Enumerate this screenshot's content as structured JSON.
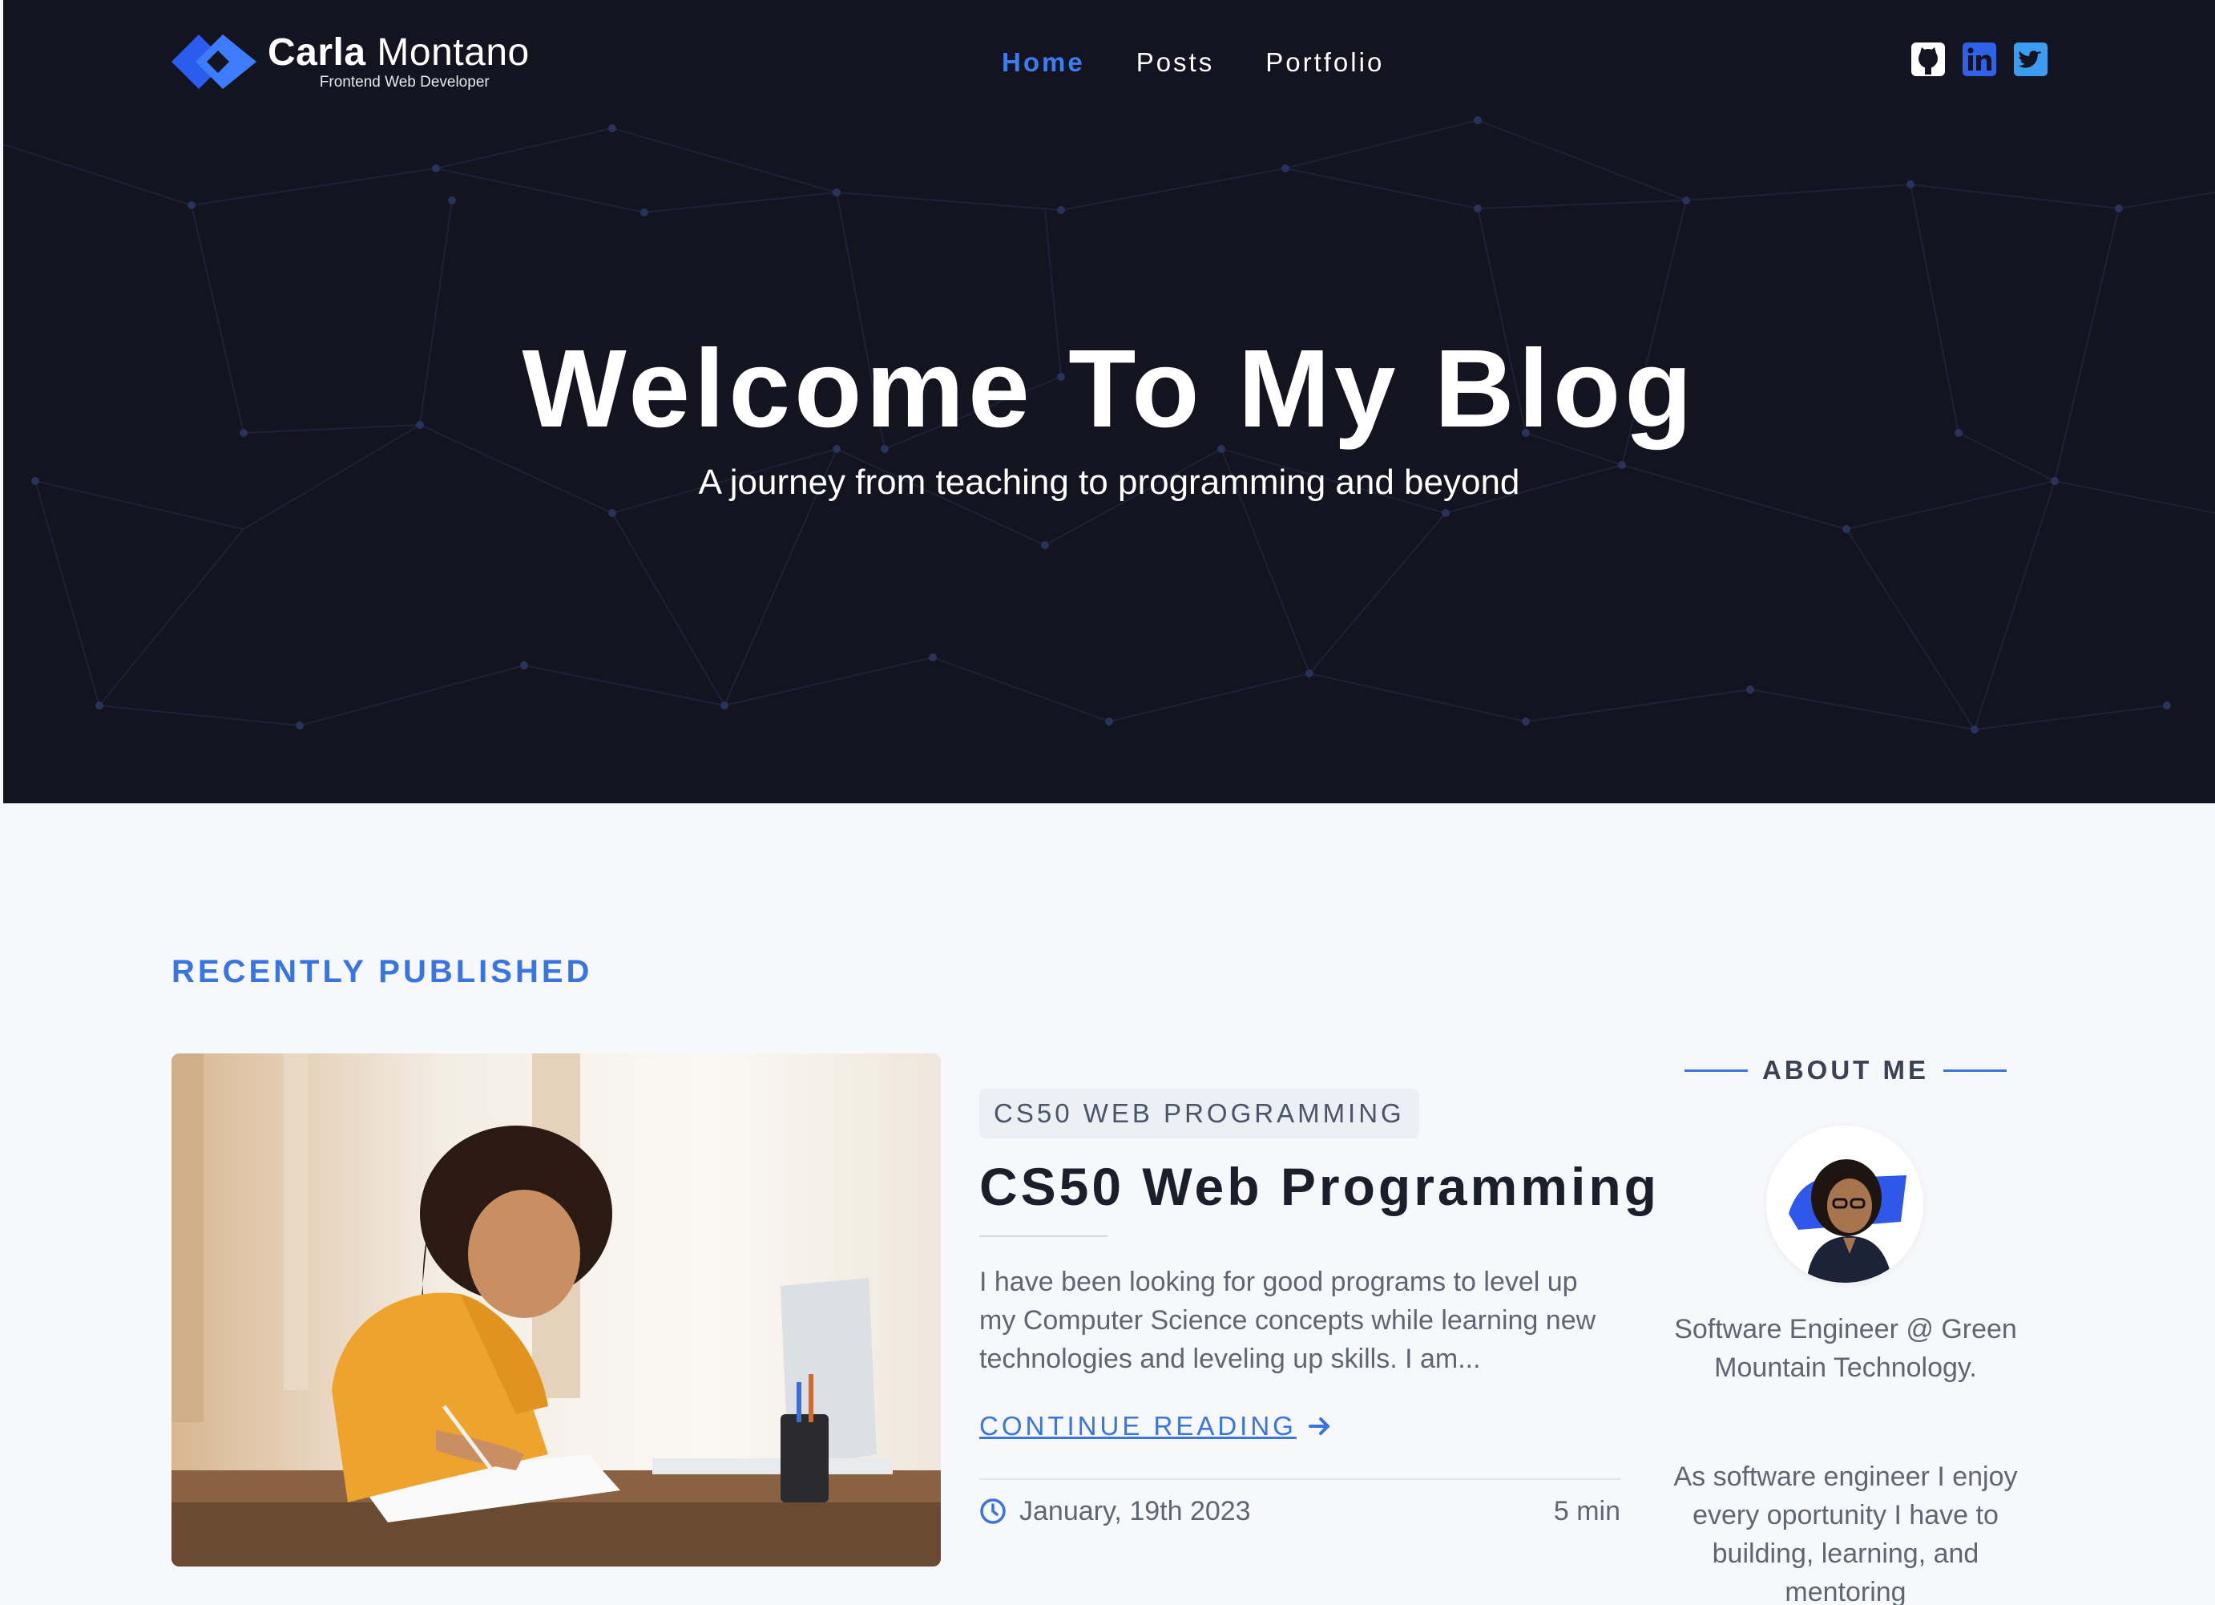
{
  "brand": {
    "first_name": "Carla",
    "last_name": "Montano",
    "tagline": "Frontend Web Developer",
    "accent": "#3b7df5"
  },
  "nav": {
    "items": [
      {
        "label": "Home",
        "active": true
      },
      {
        "label": "Posts",
        "active": false
      },
      {
        "label": "Portfolio",
        "active": false
      }
    ]
  },
  "social": {
    "icons": [
      "github-icon",
      "linkedin-icon",
      "twitter-icon"
    ]
  },
  "hero": {
    "title": "Welcome To My Blog",
    "subtitle": "A journey from teaching to programming and beyond"
  },
  "main": {
    "section_label": "RECENTLY PUBLISHED",
    "post": {
      "category": "CS50 WEB PROGRAMMING",
      "title": "CS50 Web Programming",
      "excerpt": "I have been looking for good programs to level up my Computer Science concepts while learning new technologies and leveling up skills. I am...",
      "continue_label": "CONTINUE READING",
      "date": "January, 19th 2023",
      "read_time": "5 min"
    }
  },
  "sidebar": {
    "about_heading": "ABOUT ME",
    "role": "Software Engineer @ Green Mountain Technology.",
    "bio": "As software engineer I enjoy every oportunity I have to building, learning, and mentoring"
  },
  "colors": {
    "hero_bg": "#13141f",
    "page_bg": "#f7f8fb",
    "link_blue": "#3a74e0"
  }
}
